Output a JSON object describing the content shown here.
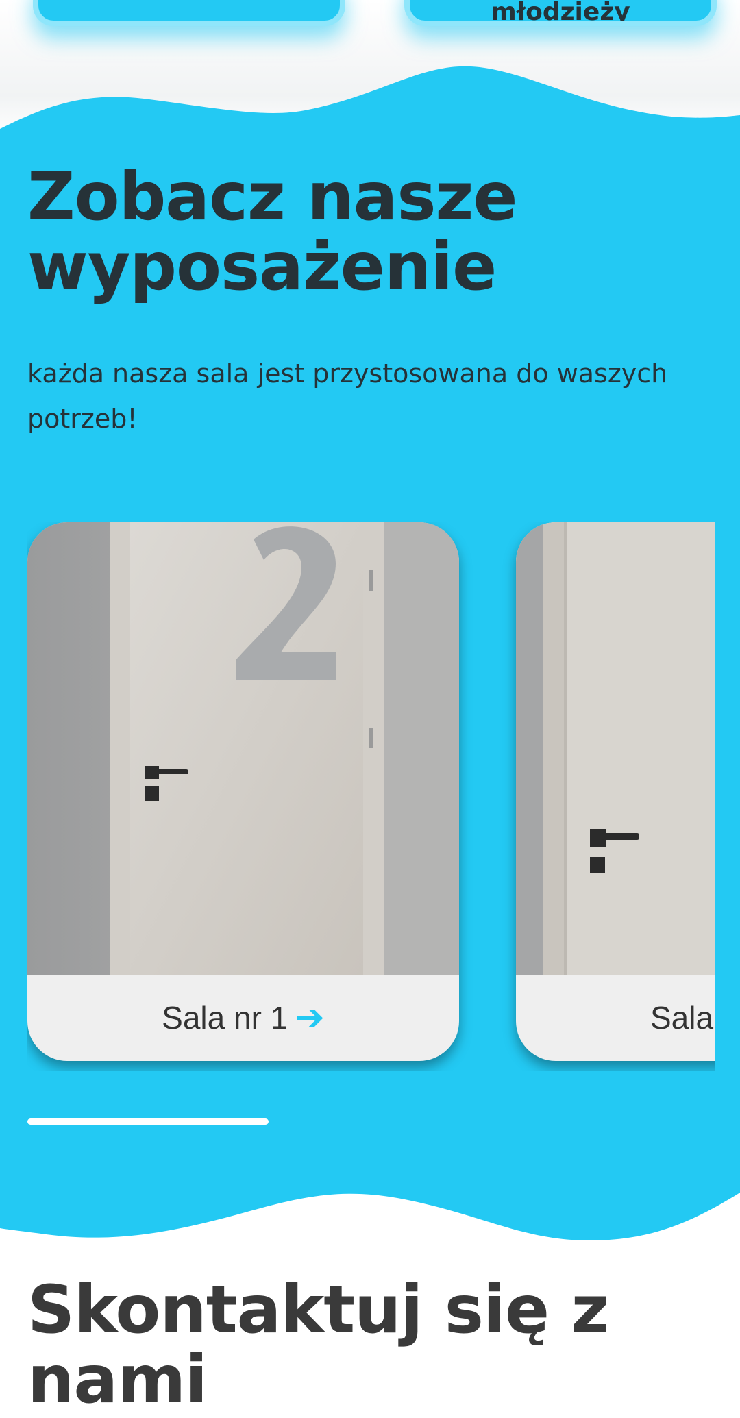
{
  "colors": {
    "accent": "#23c9f3",
    "accent_light": "#8fe6fb",
    "heading": "#263238",
    "card_bg": "#efefef"
  },
  "top_buttons": [
    {
      "label": ""
    },
    {
      "label": "młodzieży"
    }
  ],
  "equipment": {
    "title_line1": "Zobacz nasze",
    "title_line2": "wyposażenie",
    "subtitle": "każda nasza sala jest przystosowana do waszych potrzeb!"
  },
  "rooms": [
    {
      "label": "Sala nr 1",
      "arrow_icon": "arrow-right-icon",
      "door_number": "2"
    },
    {
      "label": "Sala",
      "arrow_icon": "arrow-right-icon"
    }
  ],
  "carousel": {
    "progress_fraction": 0.33
  },
  "contact": {
    "title_line1": "Skontaktuj się z",
    "title_line2": "nami"
  }
}
